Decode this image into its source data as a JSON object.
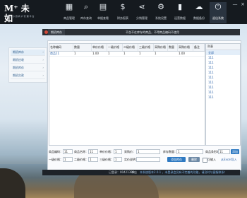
{
  "app": {
    "logo_mark": "M⁺ 未 如",
    "logo_sub": "一 站 式 小 微 商 户 管 理 平 台"
  },
  "toolbar": [
    {
      "label": "商品管理",
      "icon": "box-icon",
      "glyph": "▦"
    },
    {
      "label": "库存查询",
      "icon": "magnifier-icon",
      "glyph": "⌕"
    },
    {
      "label": "单据查看",
      "icon": "document-icon",
      "glyph": "▤"
    },
    {
      "label": "财务报表",
      "icon": "dollar-icon",
      "glyph": "$"
    },
    {
      "label": "分销管理",
      "icon": "share-icon",
      "glyph": "⋖"
    },
    {
      "label": "系统设置",
      "icon": "gear-icon",
      "glyph": "⚙"
    },
    {
      "label": "运营数据",
      "icon": "signal-bars-icon",
      "glyph": "▮"
    },
    {
      "label": "数据备份",
      "icon": "cloud-icon",
      "glyph": "☁"
    },
    {
      "label": "退出系统",
      "icon": "lock-icon",
      "glyph": "⏻",
      "active": true
    }
  ],
  "window_controls": [
    "—",
    "×"
  ],
  "subbar": {
    "tab": "期初库存",
    "title": "不含不在库存的商品，不得商品编码不使用"
  },
  "sidebar": {
    "items": [
      {
        "label": "期初库存",
        "sel": true
      },
      {
        "label": "期初应收"
      },
      {
        "label": "期初库存"
      },
      {
        "label": "期初欠款"
      }
    ]
  },
  "grid": {
    "columns": [
      "名称编码",
      "数量",
      "单价价格",
      "一级价格",
      "二级价格",
      "三级价格",
      "采购价格",
      "数量",
      "采购价格",
      "备注"
    ],
    "rows": [
      [
        "商品11",
        "1",
        "1.00",
        "1",
        "1",
        "1",
        "1",
        "",
        "1.00",
        ""
      ]
    ]
  },
  "right_list": {
    "header": "列表",
    "items": [
      "全部",
      "111",
      "111",
      "111",
      "111",
      "111",
      "111",
      "111",
      "111",
      "111"
    ]
  },
  "form": {
    "labels": {
      "code": "商品编码：",
      "name": "商品名称：",
      "unit_price": "单价价格：",
      "purchase_price": "采购价：",
      "qty": "库存数量：",
      "barcode": "商品条形码：",
      "level1": "一级价格：",
      "level2": "二级价格：",
      "level3": "三级价格：",
      "category": "商品分类：",
      "remark": "实价说明：",
      "stock_in": "入库："
    },
    "values": {
      "code": "11",
      "name": "11",
      "unit_price": "1",
      "purchase_price": "1",
      "qty": "1",
      "barcode": "11",
      "level1": "1",
      "level2": "1",
      "level3": "1",
      "category": "",
      "remark": "",
      "stock_in": "11"
    },
    "add_button": "添加",
    "confirm_button": "添加库存",
    "delete_button": "删除",
    "check_label": "可输入",
    "import_link": "从Excel导入"
  },
  "status": {
    "version": "已登录：00421399",
    "shop": "本店",
    "message": "本系统版本2.0.1 ，未登录会员有不完善的功能，请及时与客服联系！",
    "link": "技术支持",
    "tail": "商户管理"
  },
  "colors": {
    "accent": "#2f7ac2",
    "topbar": "#151a1f",
    "close_dot": "#d24a3a"
  }
}
